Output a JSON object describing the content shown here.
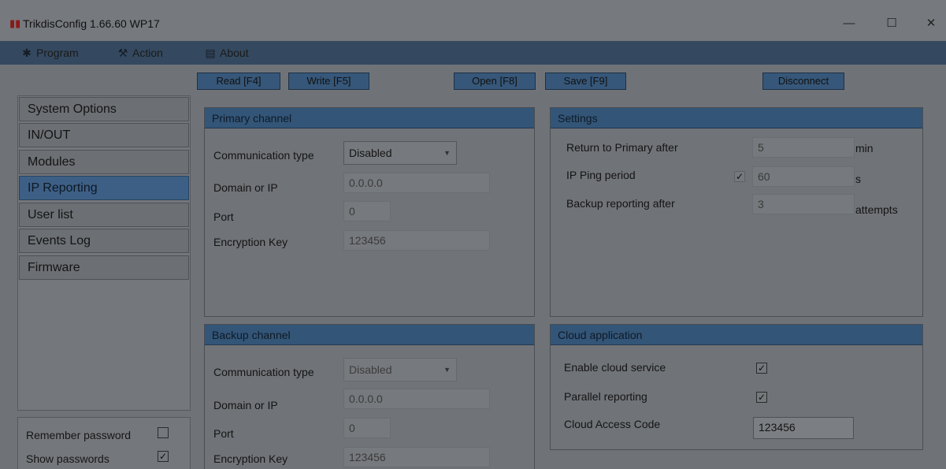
{
  "window": {
    "title": "TrikdisConfig 1.66.60   WP17",
    "minimize": "—",
    "maximize": "☐",
    "close": "✕"
  },
  "menu": {
    "program": "Program",
    "action": "Action",
    "about": "About"
  },
  "toolbar": {
    "read": "Read [F4]",
    "write": "Write [F5]",
    "open": "Open [F8]",
    "save": "Save [F9]",
    "disconnect": "Disconnect"
  },
  "sidebar": {
    "items": [
      {
        "label": "System Options"
      },
      {
        "label": "IN/OUT"
      },
      {
        "label": "Modules"
      },
      {
        "label": "IP Reporting"
      },
      {
        "label": "User list"
      },
      {
        "label": "Events Log"
      },
      {
        "label": "Firmware"
      }
    ],
    "active_index": 3
  },
  "options": {
    "remember_password": {
      "label": "Remember password",
      "checked": false
    },
    "show_passwords": {
      "label": "Show passwords",
      "checked": true
    }
  },
  "primary": {
    "header": "Primary channel",
    "comm_type_label": "Communication type",
    "comm_type_value": "Disabled",
    "domain_label": "Domain or IP",
    "domain_value": "0.0.0.0",
    "port_label": "Port",
    "port_value": "0",
    "key_label": "Encryption Key",
    "key_value": "123456"
  },
  "backup": {
    "header": "Backup channel",
    "comm_type_label": "Communication type",
    "comm_type_value": "Disabled",
    "domain_label": "Domain or IP",
    "domain_value": "0.0.0.0",
    "port_label": "Port",
    "port_value": "0",
    "key_label": "Encryption Key",
    "key_value": "123456"
  },
  "settings": {
    "header": "Settings",
    "return_label": "Return to Primary after",
    "return_value": "5",
    "return_unit": "min",
    "ping_label": "IP Ping period",
    "ping_checked": true,
    "ping_value": "60",
    "ping_unit": "s",
    "backup_label": "Backup reporting after",
    "backup_value": "3",
    "backup_unit": "attempts"
  },
  "cloud": {
    "header": "Cloud application",
    "enable_label": "Enable cloud service",
    "enable_checked": true,
    "parallel_label": "Parallel reporting",
    "parallel_checked": true,
    "code_label": "Cloud Access Code",
    "code_value": "123456"
  },
  "colors": {
    "accent": "#335577",
    "active_nav": "#3d5f85",
    "menubar": "#34495f"
  },
  "icons": {
    "program": "gear-icon",
    "action": "wrench-icon",
    "about": "book-icon",
    "app": "app-logo-icon"
  }
}
